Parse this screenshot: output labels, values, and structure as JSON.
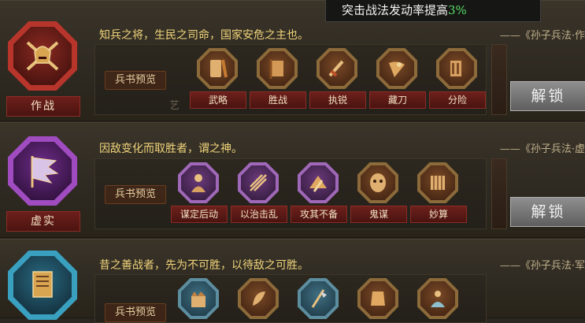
{
  "toast": {
    "text": "突击战法发动率提高",
    "percent": "3%"
  },
  "colors": {
    "quote": "#f0d47a",
    "toast_percent": "#58e06a"
  },
  "rows": [
    {
      "name": "作战",
      "emblem_icon": "crossed-swords-helmet-icon",
      "emblem_color": "#b8352c",
      "quote": "知兵之将，生民之司命，国家安危之主也。",
      "cite": "——《孙子兵法·作",
      "preview_label": "兵书预览",
      "skills": [
        {
          "label": "武略",
          "icon": "scroll-brush-icon"
        },
        {
          "label": "胜战",
          "icon": "war-banner-icon"
        },
        {
          "label": "执锐",
          "icon": "sword-icon"
        },
        {
          "label": "藏刀",
          "icon": "hidden-blade-icon"
        },
        {
          "label": "分险",
          "icon": "shield-wall-icon"
        }
      ],
      "side_char": "艺",
      "unlock_label": "解锁"
    },
    {
      "name": "虚实",
      "emblem_icon": "torn-flag-icon",
      "emblem_color": "#a04cc0",
      "quote": "因敌变化而取胜者，谓之神。",
      "cite": "——《孙子兵法·虚",
      "preview_label": "兵书预览",
      "skills": [
        {
          "label": "谋定后动",
          "icon": "strategist-icon"
        },
        {
          "label": "以治击乱",
          "icon": "arrows-icon"
        },
        {
          "label": "攻其不备",
          "icon": "ambush-icon"
        },
        {
          "label": "鬼谋",
          "icon": "mask-icon"
        },
        {
          "label": "妙算",
          "icon": "bamboo-scroll-icon"
        }
      ],
      "unlock_label": "解锁"
    },
    {
      "name": "",
      "emblem_icon": "ornate-banner-icon",
      "emblem_color": "#3aa0c0",
      "quote": "昔之善战者，先为不可胜，以待敌之可胜。",
      "cite": "——《孙子兵法·军",
      "preview_label": "兵书预览",
      "skills": [
        {
          "icon": "fortress-icon"
        },
        {
          "icon": "feather-icon"
        },
        {
          "icon": "halberd-icon"
        },
        {
          "icon": "armor-icon"
        },
        {
          "icon": "meditating-figure-icon"
        }
      ]
    }
  ]
}
